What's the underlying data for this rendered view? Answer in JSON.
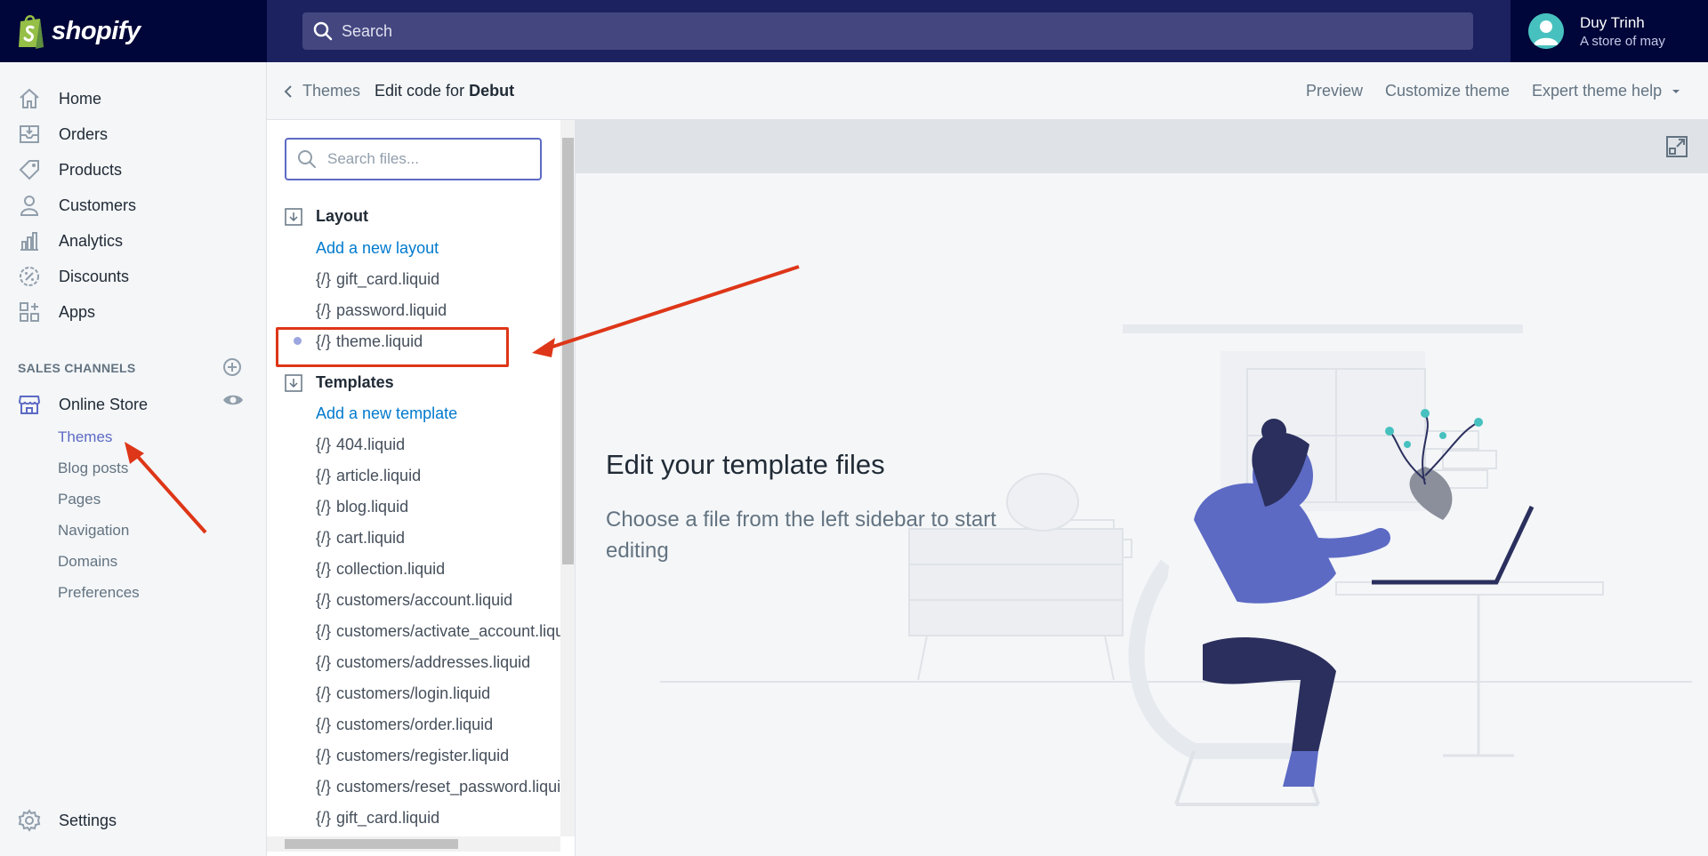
{
  "topbar": {
    "logo_text": "shopify",
    "search_placeholder": "Search",
    "user_name": "Duy Trinh",
    "user_store": "A store of may"
  },
  "nav": {
    "items": [
      {
        "label": "Home",
        "icon": "home-icon"
      },
      {
        "label": "Orders",
        "icon": "orders-icon"
      },
      {
        "label": "Products",
        "icon": "tag-icon"
      },
      {
        "label": "Customers",
        "icon": "person-icon"
      },
      {
        "label": "Analytics",
        "icon": "bar-chart-icon"
      },
      {
        "label": "Discounts",
        "icon": "discount-icon"
      },
      {
        "label": "Apps",
        "icon": "apps-icon"
      }
    ],
    "sales_channels_title": "SALES CHANNELS",
    "online_store": "Online Store",
    "sub_items": [
      "Themes",
      "Blog posts",
      "Pages",
      "Navigation",
      "Domains",
      "Preferences"
    ],
    "active_sub": "Themes",
    "settings": "Settings"
  },
  "header": {
    "back_label": "Themes",
    "title_prefix": "Edit code for",
    "theme_name": "Debut",
    "preview": "Preview",
    "customize": "Customize theme",
    "expert_help": "Expert theme help"
  },
  "files": {
    "search_placeholder": "Search files...",
    "layout_folder": "Layout",
    "add_layout": "Add a new layout",
    "layout_files": [
      "gift_card.liquid",
      "password.liquid",
      "theme.liquid"
    ],
    "templates_folder": "Templates",
    "add_template": "Add a new template",
    "template_files": [
      "404.liquid",
      "article.liquid",
      "blog.liquid",
      "cart.liquid",
      "collection.liquid",
      "customers/account.liquid",
      "customers/activate_account.liquid",
      "customers/addresses.liquid",
      "customers/login.liquid",
      "customers/order.liquid",
      "customers/register.liquid",
      "customers/reset_password.liquid",
      "gift_card.liquid"
    ],
    "brace": "{/}"
  },
  "main": {
    "heading": "Edit your template files",
    "subtext": "Choose a file from the left sidebar to start editing"
  },
  "colors": {
    "topbar": "#1c2260",
    "accent": "#5c6ac4",
    "link": "#007ace",
    "annotation": "#de3618"
  }
}
